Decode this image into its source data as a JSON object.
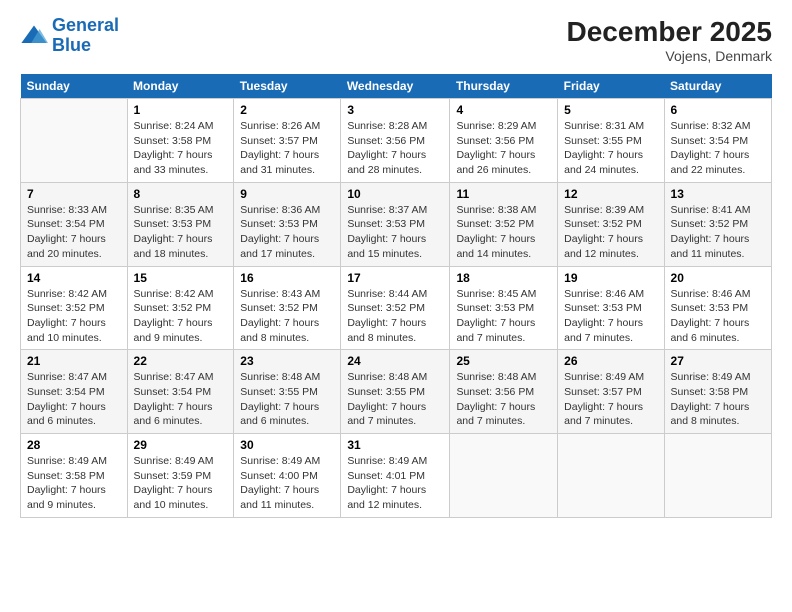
{
  "logo": {
    "line1": "General",
    "line2": "Blue"
  },
  "title": "December 2025",
  "subtitle": "Vojens, Denmark",
  "days_header": [
    "Sunday",
    "Monday",
    "Tuesday",
    "Wednesday",
    "Thursday",
    "Friday",
    "Saturday"
  ],
  "weeks": [
    [
      {
        "num": "",
        "info": ""
      },
      {
        "num": "1",
        "info": "Sunrise: 8:24 AM\nSunset: 3:58 PM\nDaylight: 7 hours\nand 33 minutes."
      },
      {
        "num": "2",
        "info": "Sunrise: 8:26 AM\nSunset: 3:57 PM\nDaylight: 7 hours\nand 31 minutes."
      },
      {
        "num": "3",
        "info": "Sunrise: 8:28 AM\nSunset: 3:56 PM\nDaylight: 7 hours\nand 28 minutes."
      },
      {
        "num": "4",
        "info": "Sunrise: 8:29 AM\nSunset: 3:56 PM\nDaylight: 7 hours\nand 26 minutes."
      },
      {
        "num": "5",
        "info": "Sunrise: 8:31 AM\nSunset: 3:55 PM\nDaylight: 7 hours\nand 24 minutes."
      },
      {
        "num": "6",
        "info": "Sunrise: 8:32 AM\nSunset: 3:54 PM\nDaylight: 7 hours\nand 22 minutes."
      }
    ],
    [
      {
        "num": "7",
        "info": "Sunrise: 8:33 AM\nSunset: 3:54 PM\nDaylight: 7 hours\nand 20 minutes."
      },
      {
        "num": "8",
        "info": "Sunrise: 8:35 AM\nSunset: 3:53 PM\nDaylight: 7 hours\nand 18 minutes."
      },
      {
        "num": "9",
        "info": "Sunrise: 8:36 AM\nSunset: 3:53 PM\nDaylight: 7 hours\nand 17 minutes."
      },
      {
        "num": "10",
        "info": "Sunrise: 8:37 AM\nSunset: 3:53 PM\nDaylight: 7 hours\nand 15 minutes."
      },
      {
        "num": "11",
        "info": "Sunrise: 8:38 AM\nSunset: 3:52 PM\nDaylight: 7 hours\nand 14 minutes."
      },
      {
        "num": "12",
        "info": "Sunrise: 8:39 AM\nSunset: 3:52 PM\nDaylight: 7 hours\nand 12 minutes."
      },
      {
        "num": "13",
        "info": "Sunrise: 8:41 AM\nSunset: 3:52 PM\nDaylight: 7 hours\nand 11 minutes."
      }
    ],
    [
      {
        "num": "14",
        "info": "Sunrise: 8:42 AM\nSunset: 3:52 PM\nDaylight: 7 hours\nand 10 minutes."
      },
      {
        "num": "15",
        "info": "Sunrise: 8:42 AM\nSunset: 3:52 PM\nDaylight: 7 hours\nand 9 minutes."
      },
      {
        "num": "16",
        "info": "Sunrise: 8:43 AM\nSunset: 3:52 PM\nDaylight: 7 hours\nand 8 minutes."
      },
      {
        "num": "17",
        "info": "Sunrise: 8:44 AM\nSunset: 3:52 PM\nDaylight: 7 hours\nand 8 minutes."
      },
      {
        "num": "18",
        "info": "Sunrise: 8:45 AM\nSunset: 3:53 PM\nDaylight: 7 hours\nand 7 minutes."
      },
      {
        "num": "19",
        "info": "Sunrise: 8:46 AM\nSunset: 3:53 PM\nDaylight: 7 hours\nand 7 minutes."
      },
      {
        "num": "20",
        "info": "Sunrise: 8:46 AM\nSunset: 3:53 PM\nDaylight: 7 hours\nand 6 minutes."
      }
    ],
    [
      {
        "num": "21",
        "info": "Sunrise: 8:47 AM\nSunset: 3:54 PM\nDaylight: 7 hours\nand 6 minutes."
      },
      {
        "num": "22",
        "info": "Sunrise: 8:47 AM\nSunset: 3:54 PM\nDaylight: 7 hours\nand 6 minutes."
      },
      {
        "num": "23",
        "info": "Sunrise: 8:48 AM\nSunset: 3:55 PM\nDaylight: 7 hours\nand 6 minutes."
      },
      {
        "num": "24",
        "info": "Sunrise: 8:48 AM\nSunset: 3:55 PM\nDaylight: 7 hours\nand 7 minutes."
      },
      {
        "num": "25",
        "info": "Sunrise: 8:48 AM\nSunset: 3:56 PM\nDaylight: 7 hours\nand 7 minutes."
      },
      {
        "num": "26",
        "info": "Sunrise: 8:49 AM\nSunset: 3:57 PM\nDaylight: 7 hours\nand 7 minutes."
      },
      {
        "num": "27",
        "info": "Sunrise: 8:49 AM\nSunset: 3:58 PM\nDaylight: 7 hours\nand 8 minutes."
      }
    ],
    [
      {
        "num": "28",
        "info": "Sunrise: 8:49 AM\nSunset: 3:58 PM\nDaylight: 7 hours\nand 9 minutes."
      },
      {
        "num": "29",
        "info": "Sunrise: 8:49 AM\nSunset: 3:59 PM\nDaylight: 7 hours\nand 10 minutes."
      },
      {
        "num": "30",
        "info": "Sunrise: 8:49 AM\nSunset: 4:00 PM\nDaylight: 7 hours\nand 11 minutes."
      },
      {
        "num": "31",
        "info": "Sunrise: 8:49 AM\nSunset: 4:01 PM\nDaylight: 7 hours\nand 12 minutes."
      },
      {
        "num": "",
        "info": ""
      },
      {
        "num": "",
        "info": ""
      },
      {
        "num": "",
        "info": ""
      }
    ]
  ]
}
